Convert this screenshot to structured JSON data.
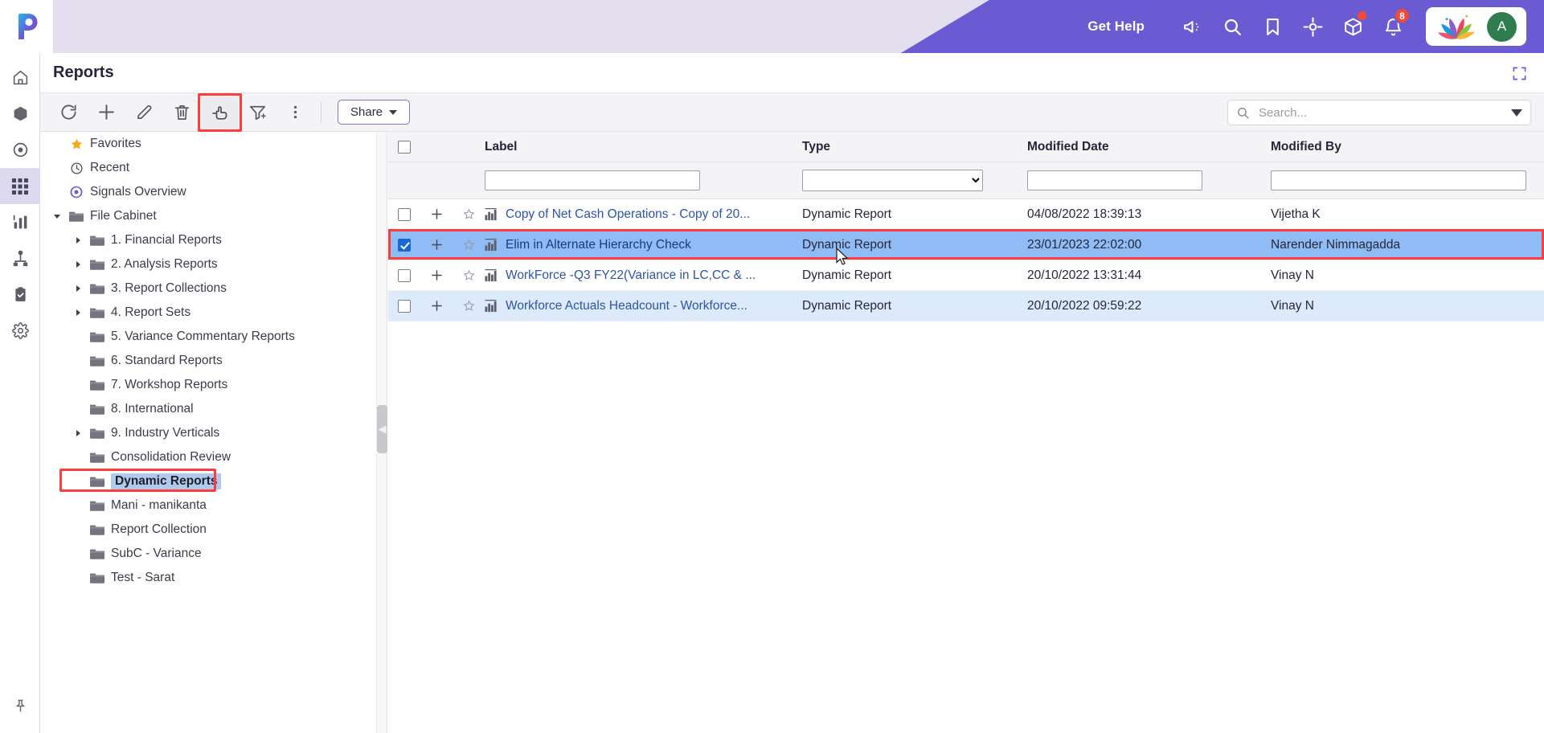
{
  "topbar": {
    "get_help": "Get Help",
    "icons": [
      {
        "name": "announcement-icon",
        "badge": null
      },
      {
        "name": "search-icon",
        "badge": null
      },
      {
        "name": "bookmark-icon",
        "badge": null
      },
      {
        "name": "target-icon",
        "badge": null
      },
      {
        "name": "package-icon",
        "badge": "dot"
      },
      {
        "name": "notifications-bell-icon",
        "badge": "8"
      }
    ],
    "notification_count": "8",
    "avatar_initial": "A",
    "brand_color": "#6b5bd2"
  },
  "rail": {
    "items": [
      {
        "name": "home-icon",
        "active": false
      },
      {
        "name": "cube-icon",
        "active": false
      },
      {
        "name": "target-circle-icon",
        "active": false
      },
      {
        "name": "grid-apps-icon",
        "active": true
      },
      {
        "name": "bar-chart-icon",
        "active": false
      },
      {
        "name": "hierarchy-icon",
        "active": false
      },
      {
        "name": "clipboard-check-icon",
        "active": false
      },
      {
        "name": "gear-icon",
        "active": false
      }
    ],
    "pin": {
      "name": "pin-icon"
    }
  },
  "header": {
    "title": "Reports",
    "expand_icon": "fullscreen-expand-icon"
  },
  "toolbar": {
    "buttons": [
      {
        "name": "refresh-button",
        "icon": "refresh-icon",
        "highlighted": false
      },
      {
        "name": "add-button",
        "icon": "plus-icon",
        "highlighted": false
      },
      {
        "name": "edit-button",
        "icon": "pencil-icon",
        "highlighted": false
      },
      {
        "name": "delete-button",
        "icon": "trash-icon",
        "highlighted": false
      },
      {
        "name": "move-button",
        "icon": "move-right-hand-icon",
        "highlighted": true
      },
      {
        "name": "filter-button",
        "icon": "funnel-icon",
        "highlighted": false
      },
      {
        "name": "more-options-button",
        "icon": "kebab-menu-icon",
        "highlighted": false
      }
    ],
    "share_label": "Share",
    "search_placeholder": "Search...",
    "search_value": ""
  },
  "tree": {
    "items": [
      {
        "label": "Favorites",
        "icon": "star-icon",
        "arrow": "none",
        "indent": 1,
        "selected": false
      },
      {
        "label": "Recent",
        "icon": "clock-icon",
        "arrow": "none",
        "indent": 1,
        "selected": false
      },
      {
        "label": "Signals Overview",
        "icon": "signals-icon",
        "arrow": "none",
        "indent": 1,
        "selected": false
      },
      {
        "label": "File Cabinet",
        "icon": "folder-icon",
        "arrow": "down",
        "indent": 1,
        "selected": false
      },
      {
        "label": "1. Financial Reports",
        "icon": "folder-icon",
        "arrow": "right",
        "indent": 2,
        "selected": false
      },
      {
        "label": "2. Analysis Reports",
        "icon": "folder-icon",
        "arrow": "right",
        "indent": 2,
        "selected": false
      },
      {
        "label": "3. Report Collections",
        "icon": "folder-icon",
        "arrow": "right",
        "indent": 2,
        "selected": false
      },
      {
        "label": "4. Report Sets",
        "icon": "folder-icon",
        "arrow": "right",
        "indent": 2,
        "selected": false
      },
      {
        "label": "5. Variance Commentary Reports",
        "icon": "folder-icon",
        "arrow": "none",
        "indent": 2,
        "selected": false
      },
      {
        "label": "6. Standard Reports",
        "icon": "folder-icon",
        "arrow": "none",
        "indent": 2,
        "selected": false
      },
      {
        "label": "7. Workshop Reports",
        "icon": "folder-icon",
        "arrow": "none",
        "indent": 2,
        "selected": false
      },
      {
        "label": "8. International",
        "icon": "folder-icon",
        "arrow": "none",
        "indent": 2,
        "selected": false
      },
      {
        "label": "9. Industry Verticals",
        "icon": "folder-icon",
        "arrow": "right",
        "indent": 2,
        "selected": false
      },
      {
        "label": "Consolidation Review",
        "icon": "folder-icon",
        "arrow": "none",
        "indent": 2,
        "selected": false
      },
      {
        "label": "Dynamic Reports",
        "icon": "folder-icon",
        "arrow": "none",
        "indent": 2,
        "selected": true
      },
      {
        "label": "Mani - manikanta",
        "icon": "folder-icon",
        "arrow": "none",
        "indent": 2,
        "selected": false
      },
      {
        "label": "Report Collection",
        "icon": "folder-icon",
        "arrow": "none",
        "indent": 2,
        "selected": false
      },
      {
        "label": "SubC - Variance",
        "icon": "folder-icon",
        "arrow": "none",
        "indent": 2,
        "selected": false
      },
      {
        "label": "Test - Sarat",
        "icon": "folder-icon",
        "arrow": "none",
        "indent": 2,
        "selected": false
      }
    ],
    "highlight_color": "#fc3d3d"
  },
  "table": {
    "columns": [
      "Label",
      "Type",
      "Modified Date",
      "Modified By"
    ],
    "filters": {
      "label_value": "",
      "type_value": "",
      "modified_date_value": "",
      "modified_by_value": ""
    },
    "rows": [
      {
        "label": "Copy of Net Cash Operations - Copy of 20...",
        "type": "Dynamic Report",
        "modified_date": "04/08/2022 18:39:13",
        "modified_by": "Vijetha K",
        "checked": false,
        "selected": false,
        "alt": false
      },
      {
        "label": "Elim in Alternate Hierarchy Check",
        "type": "Dynamic Report",
        "modified_date": "23/01/2023 22:02:00",
        "modified_by": "Narender Nimmagadda",
        "checked": true,
        "selected": true,
        "alt": false
      },
      {
        "label": "WorkForce -Q3 FY22(Variance in LC,CC & ...",
        "type": "Dynamic Report",
        "modified_date": "20/10/2022 13:31:44",
        "modified_by": "Vinay N",
        "checked": false,
        "selected": false,
        "alt": false
      },
      {
        "label": "Workforce Actuals Headcount - Workforce...",
        "type": "Dynamic Report",
        "modified_date": "20/10/2022 09:59:22",
        "modified_by": "Vinay N",
        "checked": false,
        "selected": false,
        "alt": true
      }
    ],
    "select_all_checked": false
  }
}
